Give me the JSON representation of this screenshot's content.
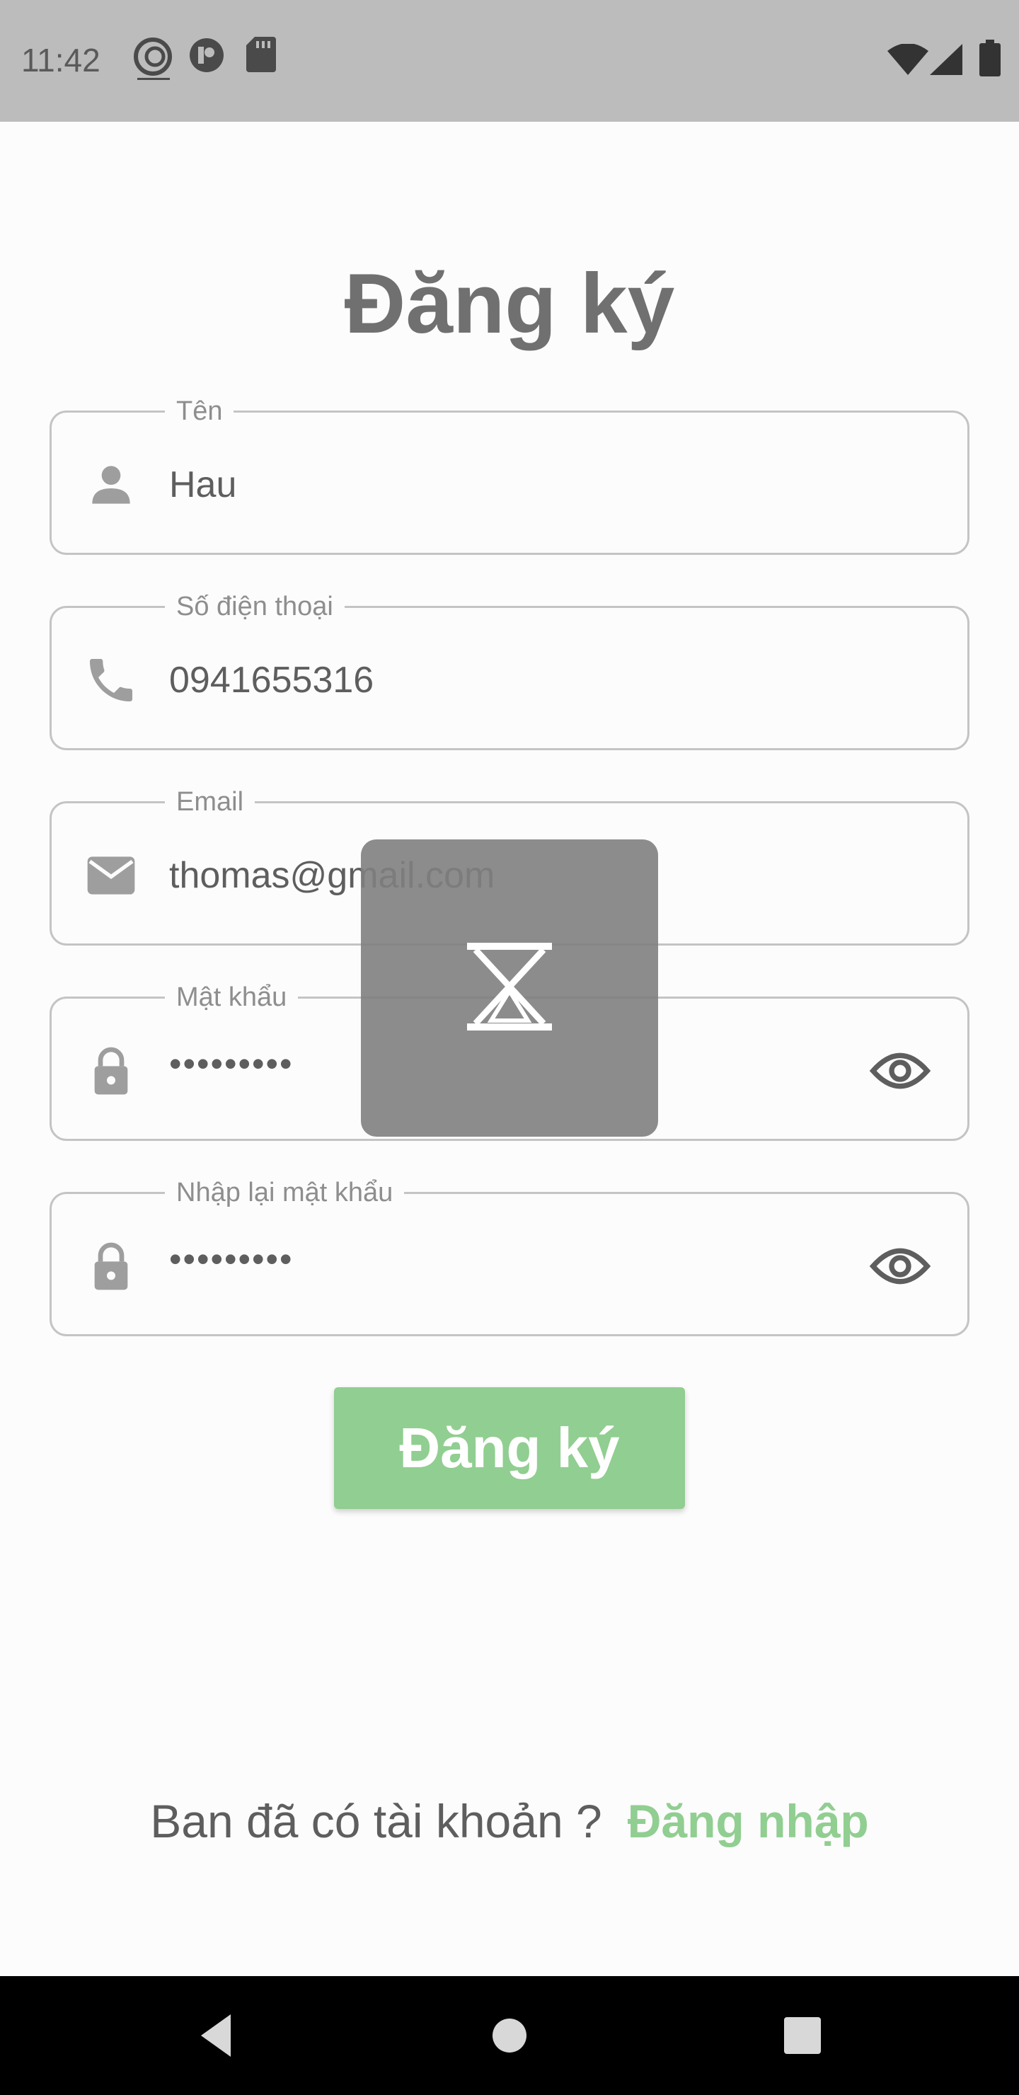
{
  "status_bar": {
    "time": "11:42",
    "icons": [
      "app-logo-icon",
      "notification-icon",
      "sd-card-icon",
      "wifi-icon",
      "signal-icon",
      "battery-icon"
    ]
  },
  "page": {
    "title": "Đăng ký"
  },
  "form": {
    "name": {
      "label": "Tên",
      "value": "Hau",
      "icon": "person-icon"
    },
    "phone": {
      "label": "Số điện thoại",
      "value": "0941655316",
      "icon": "phone-icon"
    },
    "email": {
      "label": "Email",
      "value": "thomas@gmail.com",
      "icon": "email-icon"
    },
    "password": {
      "label": "Mật khẩu",
      "value": "•••••••••",
      "icon": "lock-icon"
    },
    "confirm_password": {
      "label": "Nhập lại mật khẩu",
      "value": "•••••••••",
      "icon": "lock-icon"
    }
  },
  "submit_label": "Đăng ký",
  "login_prompt": {
    "text": "Ban đã có tài khoản ?",
    "link": "Đăng nhập"
  },
  "colors": {
    "accent": "#91ce91",
    "status_bar": "#bcbcbc",
    "overlay": "#8a8a8a"
  }
}
